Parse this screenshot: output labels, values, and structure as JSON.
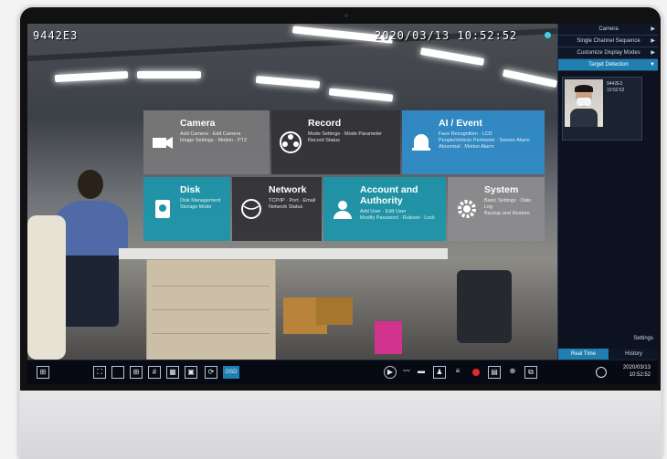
{
  "camera_osd": {
    "id": "9442E3",
    "datetime": "2020/03/13  10:52:52"
  },
  "menu": {
    "camera": {
      "title": "Camera",
      "sub": "Add Camera · Edit Camera\nImage Settings · Motion · PTZ"
    },
    "record": {
      "title": "Record",
      "sub": "Mode Settings · Mode Parameter\nRecord Status"
    },
    "ai_event": {
      "title": "AI / Event",
      "sub": "Face Recognition · LCD\nPeople/Vehicle Perimeter · Sensor Alarm\nAbnormal · Motion Alarm"
    },
    "disk": {
      "title": "Disk",
      "sub": "Disk Management\nStorage Mode"
    },
    "network": {
      "title": "Network",
      "sub": "TCP/IP · Port · Email\nNetwork Status"
    },
    "account": {
      "title": "Account and Authority",
      "sub": "Add User · Edit User\nModify Password · Ruleset · Lock"
    },
    "system": {
      "title": "System",
      "sub": "Basic Settings · Date Log\nBackup and Restore"
    }
  },
  "panel": {
    "items": [
      {
        "label": "Camera",
        "arrow": "▶"
      },
      {
        "label": "Single Channel Sequence",
        "arrow": "▶"
      },
      {
        "label": "Customize Display Modes",
        "arrow": "▶"
      },
      {
        "label": "Target Detection",
        "arrow": "▼"
      }
    ],
    "thumb_text": "9442E3\n10:52:52",
    "settings": "Settings",
    "tabs": [
      "Real Time",
      "History"
    ]
  },
  "taskbar": {
    "osd_label": "OSD",
    "clock_date": "2020/03/13",
    "clock_time": "10:52:52"
  },
  "colors": {
    "accent": "#1e7fb0",
    "tile_blue": "#308cc8",
    "tile_teal": "#1c96aa",
    "alarm_red": "#e0282e"
  }
}
